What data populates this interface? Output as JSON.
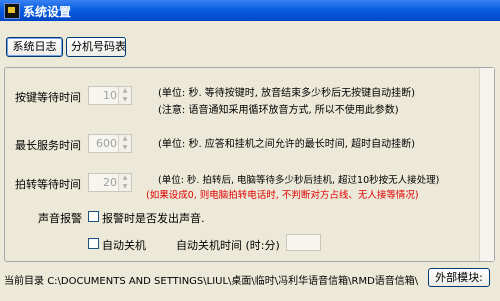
{
  "window": {
    "title": "系统设置"
  },
  "tabs": {
    "system_log": "系统日志",
    "extension_table": "分机号码表"
  },
  "settings": {
    "key_wait": {
      "label": "按键等待时间",
      "value": "10",
      "note1": "(单位: 秒. 等待按键时, 放音结束多少秒后无按键自动挂断)",
      "note2": "(注意: 语音通知采用循环放音方式, 所以不使用此参数)"
    },
    "max_service": {
      "label": "最长服务时间",
      "value": "600",
      "note": "(单位: 秒. 应答和挂机之间允许的最长时间, 超时自动挂断)"
    },
    "transfer_wait": {
      "label": "拍转等待时间",
      "value": "20",
      "note1": "(单位: 秒. 拍转后, 电脑等待多少秒后挂机, 超过10秒按无人接处理)",
      "note2": "(如果设成0, 则电脑拍转电话时, 不判断对方占线、无人接等情况)"
    },
    "sound_alarm": {
      "label": "声音报警",
      "checkbox_label": "报警时是否发出声音."
    },
    "auto_shutdown": {
      "checkbox_label": "自动关机",
      "time_label": "自动关机时间 (时:分)",
      "time_value": ""
    }
  },
  "status": {
    "current_dir_label": "当前目录",
    "current_dir": "C:\\DOCUMENTS AND SETTINGS\\LIUL\\桌面\\临时\\冯利华语音信箱\\RMD语音信箱\\",
    "external_module_button": "外部模块:"
  },
  "colors": {
    "title_bar": "#0a5fe0",
    "red_text": "#e00000",
    "face": "#ece9d8"
  }
}
